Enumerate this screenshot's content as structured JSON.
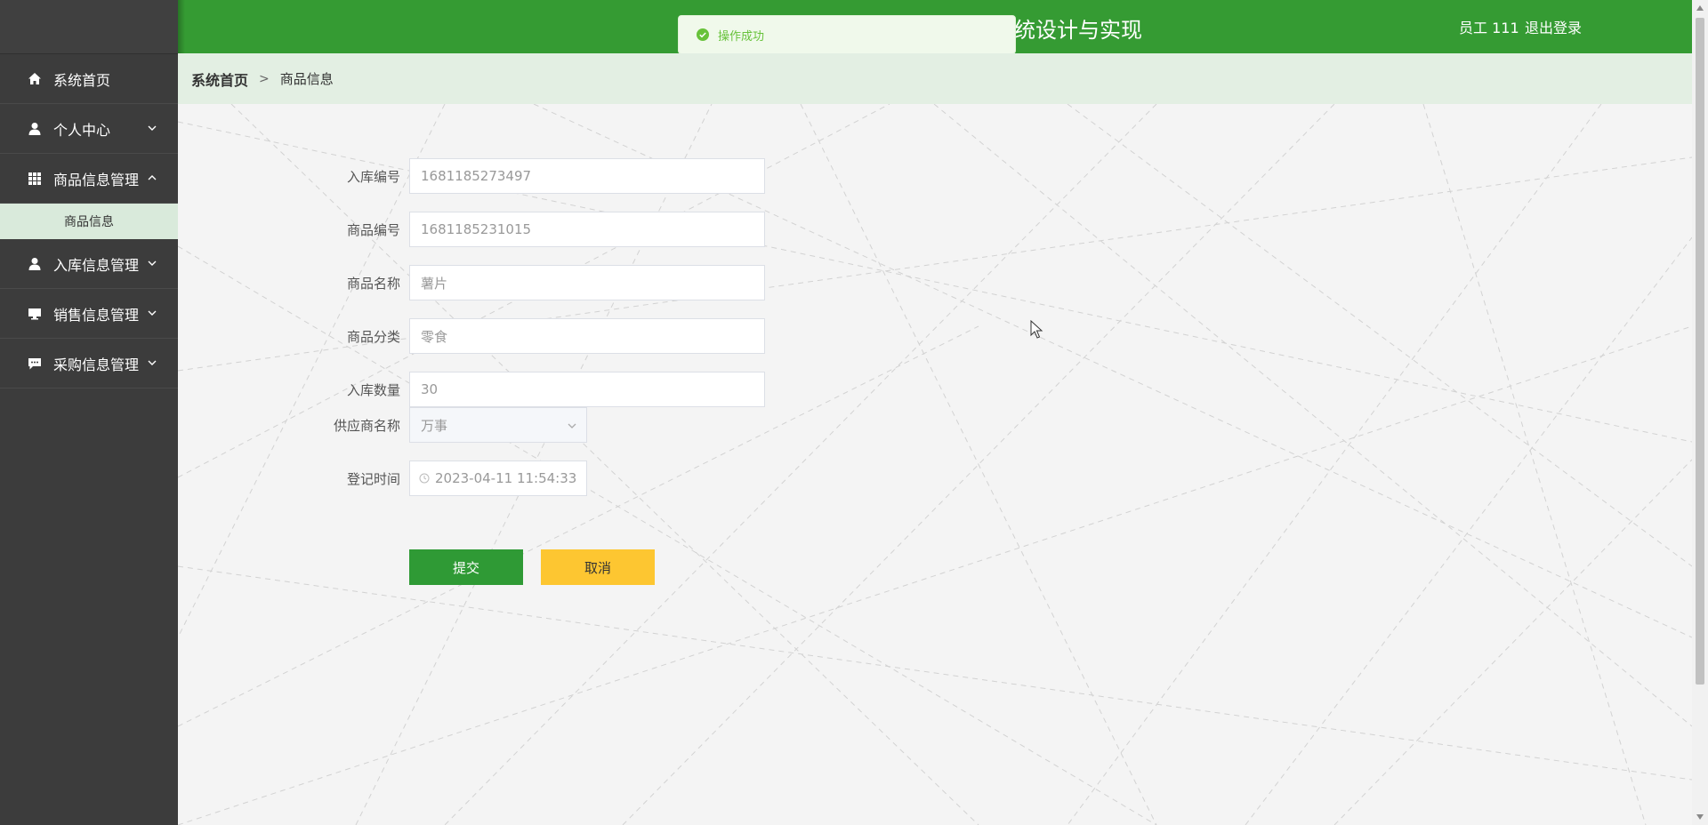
{
  "header": {
    "title": "统设计与实现",
    "user": "员工 111",
    "logout": "退出登录"
  },
  "toast": {
    "text": "操作成功"
  },
  "sidebar": {
    "items": [
      {
        "label": "系统首页",
        "icon": "home-icon"
      },
      {
        "label": "个人中心",
        "icon": "user-icon"
      },
      {
        "label": "商品信息管理",
        "icon": "grid-icon"
      },
      {
        "label": "入库信息管理",
        "icon": "user-icon"
      },
      {
        "label": "销售信息管理",
        "icon": "monitor-icon"
      },
      {
        "label": "采购信息管理",
        "icon": "chat-icon"
      }
    ],
    "subitem": "商品信息"
  },
  "breadcrumb": {
    "home": "系统首页",
    "sep": ">",
    "current": "商品信息"
  },
  "form": {
    "fields": [
      {
        "label": "入库编号",
        "value": "1681185273497"
      },
      {
        "label": "商品编号",
        "value": "1681185231015"
      },
      {
        "label": "商品名称",
        "value": "薯片"
      },
      {
        "label": "商品分类",
        "value": "零食"
      },
      {
        "label": "入库数量",
        "value": "30"
      },
      {
        "label": "供应商名称",
        "value": "万事"
      },
      {
        "label": "登记时间",
        "value": "2023-04-11 11:54:33"
      }
    ],
    "submit": "提交",
    "cancel": "取消"
  },
  "colors": {
    "header": "#359b33",
    "sidebar": "#3c3c3c",
    "submit": "#2f9a35",
    "cancel": "#fdc631",
    "toast_text": "#67c23a"
  }
}
